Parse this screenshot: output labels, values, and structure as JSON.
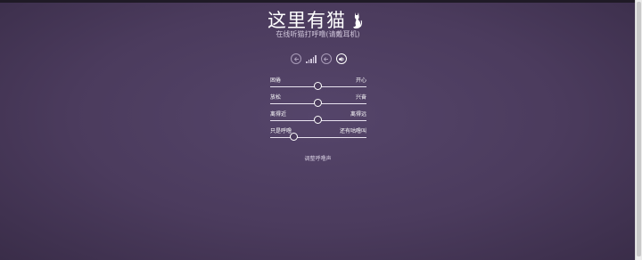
{
  "header": {
    "title": "这里有猫",
    "subtitle": "在线听猫打呼噜(请戴耳机)"
  },
  "player": {
    "prev_icon": "arrow-left-circle-icon",
    "volume_icon": "signal-bars-icon",
    "next_icon": "arrow-left-circle-icon",
    "speaker_icon": "speaker-icon"
  },
  "sliders": [
    {
      "left_label": "困倦",
      "right_label": "开心",
      "value": 0.5
    },
    {
      "left_label": "放松",
      "right_label": "兴奋",
      "value": 0.5
    },
    {
      "left_label": "离得近",
      "right_label": "离得远",
      "value": 0.5
    },
    {
      "left_label": "只是呼噜",
      "right_label": "还有咕噜叫",
      "value": 0.25
    }
  ],
  "footer": {
    "hint": "调整呼噜声"
  }
}
